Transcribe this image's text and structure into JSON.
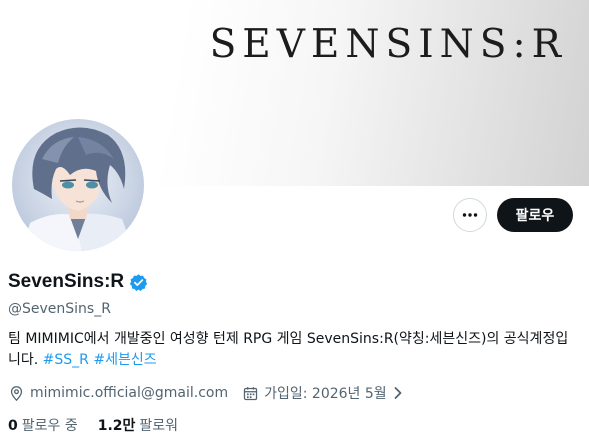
{
  "banner": {
    "logo_text": "SEVENSINS:R"
  },
  "actions": {
    "more_icon": "more-dots-icon",
    "follow_label": "팔로우"
  },
  "profile": {
    "display_name": "SevenSins:R",
    "verified_icon": "verified-badge-icon",
    "verified_color": "#1d9bf0",
    "handle": "@SevenSins_R",
    "bio_text": "팀 MIMIMIC에서 개발중인 여성향 턴제 RPG 게임 SevenSins:R(약칭:세븐신즈)의 공식계정입니다.",
    "bio_hashtags": [
      "#SS_R",
      "#세븐신즈"
    ],
    "email": "mimimic.official@gmail.com",
    "joined": "가입일: 2026년 5월"
  },
  "stats": {
    "following_count": "0",
    "following_label": "팔로우 중",
    "followers_count": "1.2만",
    "followers_label": "팔로워"
  },
  "colors": {
    "accent": "#1d9bf0",
    "text_primary": "#0f1419",
    "text_secondary": "#536471",
    "button_dark": "#0f1419"
  }
}
